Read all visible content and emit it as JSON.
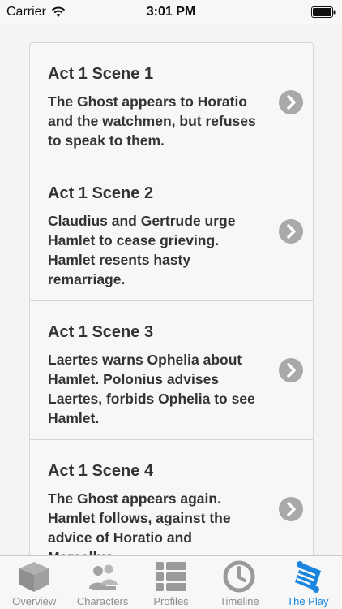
{
  "status_bar": {
    "carrier": "Carrier",
    "time": "3:01 PM"
  },
  "scenes": [
    {
      "title": "Act 1 Scene 1",
      "description": "The Ghost appears to Horatio and the watchmen, but refuses to speak to them."
    },
    {
      "title": "Act 1 Scene 2",
      "description": "Claudius and Gertrude urge Hamlet to cease grieving. Hamlet resents hasty remarriage."
    },
    {
      "title": "Act 1 Scene 3",
      "description": "Laertes warns Ophelia about Hamlet. Polonius advises Laertes, forbids Ophelia to see Hamlet."
    },
    {
      "title": "Act 1 Scene 4",
      "description": "The Ghost appears again. Hamlet follows, against the advice of Horatio and Marcellus."
    }
  ],
  "tab_bar": {
    "tabs": [
      {
        "label": "Overview",
        "icon": "cube-icon"
      },
      {
        "label": "Characters",
        "icon": "people-icon"
      },
      {
        "label": "Profiles",
        "icon": "list-icon"
      },
      {
        "label": "Timeline",
        "icon": "clock-icon"
      },
      {
        "label": "The Play",
        "icon": "scroll-icon"
      }
    ],
    "active": "The Play",
    "active_color": "#1a86e0",
    "inactive_color": "#8e8e8e"
  }
}
